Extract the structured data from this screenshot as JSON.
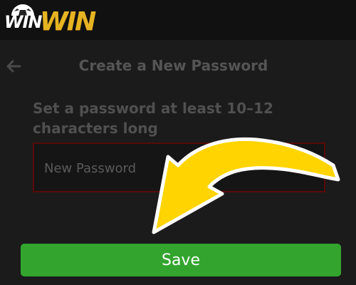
{
  "header": {
    "logo_text_small": "WIN",
    "logo_text_large": "WIN",
    "logo_color": "#e6b422"
  },
  "page": {
    "title": "Create a New Password",
    "back_icon": "arrow-left-icon"
  },
  "form": {
    "instruction": "Set a password at least 10–12 characters long",
    "password_placeholder": "New Password",
    "password_value": "",
    "field_border_color": "#5a0a0a"
  },
  "actions": {
    "save_label": "Save",
    "save_color": "#33a52e"
  },
  "overlay": {
    "arrow_icon": "curved-arrow-icon",
    "arrow_color": "#ffd400"
  }
}
